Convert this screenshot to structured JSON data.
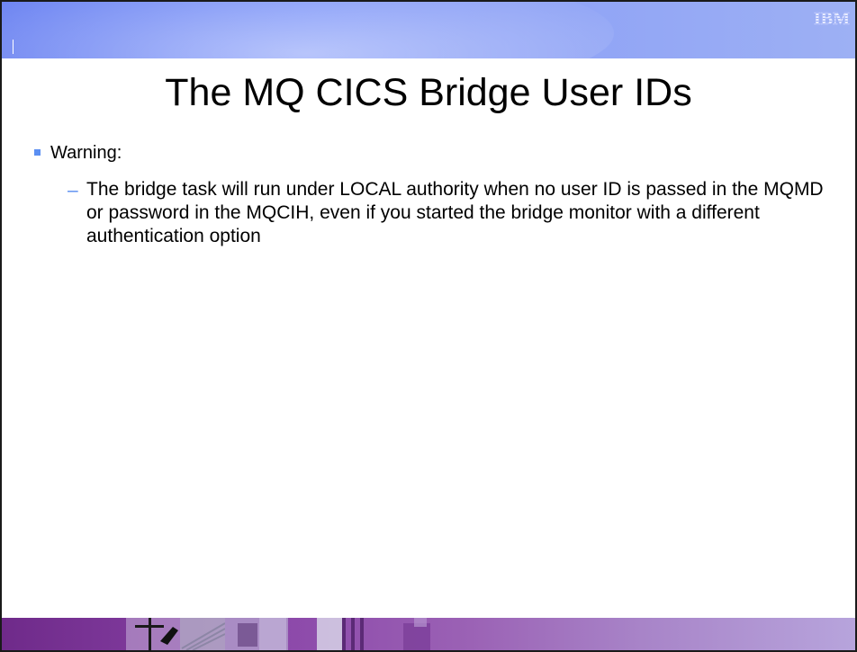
{
  "slide": {
    "title": "The MQ CICS Bridge User IDs",
    "logo_text": "IBM",
    "bullets": [
      {
        "level": 1,
        "text": "Warning:"
      },
      {
        "level": 2,
        "text": "The bridge task will run under LOCAL authority when no user ID is passed in the MQMD or password in the MQCIH, even if you started the bridge monitor with a different authentication option"
      }
    ],
    "colors": {
      "top_banner": "#7d95f8",
      "bullet_accent": "#5b8ff2",
      "bottom_banner": "#8a45a8"
    }
  }
}
